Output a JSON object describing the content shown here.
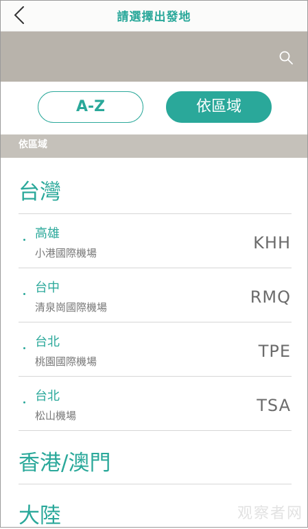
{
  "header": {
    "title": "請選擇出發地",
    "back_icon": "chevron-left-icon"
  },
  "search": {
    "icon": "search-icon"
  },
  "toggle": {
    "az_label": "A-Z",
    "region_label": "依區域",
    "active": "region"
  },
  "section": {
    "label": "依區域"
  },
  "regions": [
    {
      "title": "台灣"
    },
    {
      "title": "香港/澳門"
    },
    {
      "title": "大陸"
    }
  ],
  "airports": [
    {
      "city": "高雄",
      "name": "小港國際機場",
      "code": "KHH"
    },
    {
      "city": "台中",
      "name": "清泉崗國際機場",
      "code": "RMQ"
    },
    {
      "city": "台北",
      "name": "桃園國際機場",
      "code": "TPE"
    },
    {
      "city": "台北",
      "name": "松山機場",
      "code": "TSA"
    }
  ],
  "watermark": "观察者网",
  "colors": {
    "accent": "#2aa89a",
    "search_bar": "#b8b3ab",
    "section_bar": "#c5c1ba"
  }
}
